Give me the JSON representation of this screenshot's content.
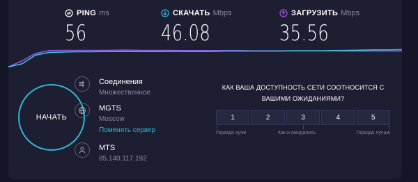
{
  "metrics": {
    "ping": {
      "label": "PING",
      "unit": "ms",
      "value": "56",
      "icon": "ping-icon",
      "color": "#ffffff"
    },
    "download": {
      "label": "СКАЧАТЬ",
      "unit": "Mbps",
      "value": "46.08",
      "icon": "download-icon",
      "color": "#2eb8d6"
    },
    "upload": {
      "label": "ЗАГРУЗИТЬ",
      "unit": "Mbps",
      "value": "35.56",
      "icon": "upload-icon",
      "color": "#9b5de5"
    }
  },
  "graph": {
    "download_color": "#3ec3d2",
    "upload_color": "#8e54e9",
    "download_trace": [
      0.05,
      0.18,
      0.55,
      0.66,
      0.68,
      0.69,
      0.69,
      0.7,
      0.7,
      0.7,
      0.7,
      0.7,
      0.71,
      0.71,
      0.71,
      0.71,
      0.72,
      0.72,
      0.72,
      0.72,
      0.72,
      0.73,
      0.73,
      0.73,
      0.74,
      0.75,
      0.76,
      0.77,
      0.77,
      0.78
    ],
    "upload_trace": [
      0.05,
      0.3,
      0.62,
      0.74,
      0.75,
      0.75,
      0.75,
      0.75,
      0.76,
      0.76,
      0.75,
      0.75,
      0.75,
      0.74,
      0.74,
      0.74,
      0.74,
      0.74,
      0.73,
      0.73,
      0.73,
      0.73,
      0.73,
      0.73,
      0.73,
      0.72,
      0.72,
      0.72,
      0.72,
      0.72
    ]
  },
  "start_button": {
    "label": "НАЧАТЬ",
    "accent": "#2eb8d6"
  },
  "connection": {
    "icon": "connections-icon",
    "title": "Соединения",
    "subtitle": "Множественное"
  },
  "server": {
    "icon": "globe-icon",
    "provider": "MGTS",
    "city": "Moscow",
    "change_link": "Поменять сервер"
  },
  "client": {
    "icon": "user-icon",
    "isp": "MTS",
    "ip": "85.140.117.192"
  },
  "survey": {
    "question_line1": "КАК ВАША ДОСТУПНОСТЬ СЕТИ СООТНОСИТСЯ С",
    "question_line2": "ВАШИМИ ОЖИДАНИЯМИ?",
    "options": [
      "1",
      "2",
      "3",
      "4",
      "5"
    ],
    "label_low": "Гораздо хуже",
    "label_mid": "Как и ожидалось",
    "label_high": "Гораздо лучше"
  }
}
